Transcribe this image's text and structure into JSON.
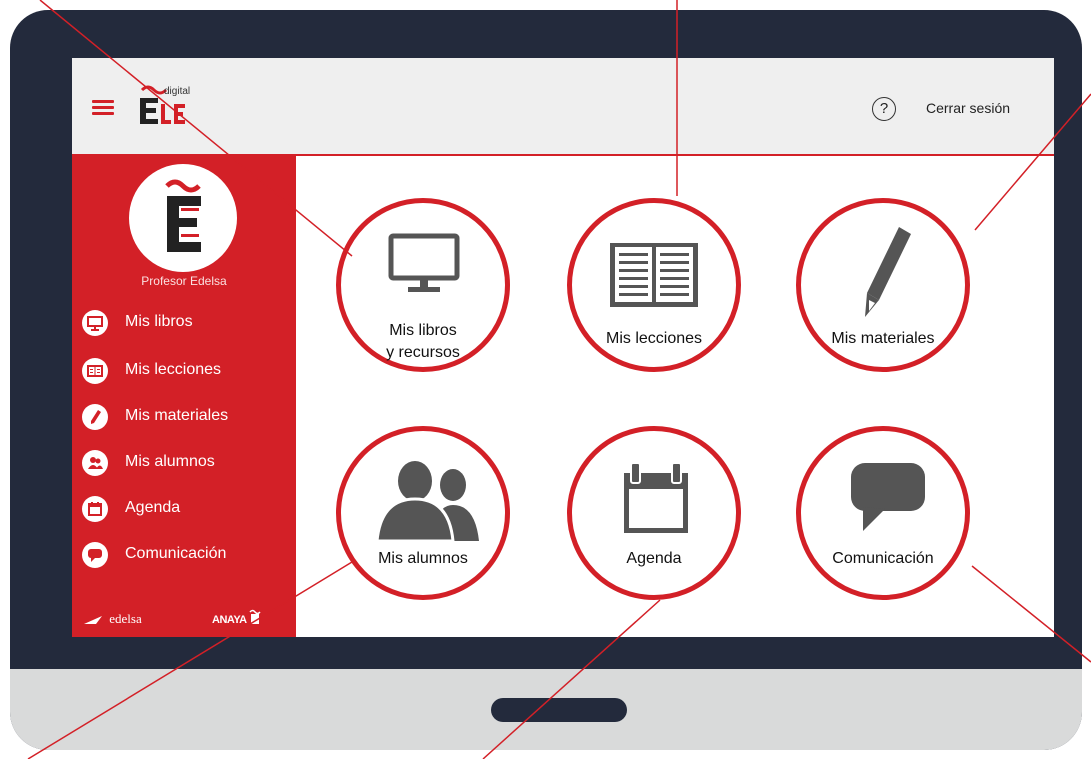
{
  "app": {
    "logo_small": "digital",
    "logo_text": "ELE"
  },
  "header": {
    "help_icon": "?",
    "logout_label": "Cerrar sesión"
  },
  "sidebar": {
    "profile_name": "Profesor Edelsa",
    "items": [
      {
        "label": "Mis libros",
        "icon": "monitor-icon"
      },
      {
        "label": "Mis lecciones",
        "icon": "book-icon"
      },
      {
        "label": "Mis materiales",
        "icon": "pencil-icon"
      },
      {
        "label": "Mis alumnos",
        "icon": "users-icon"
      },
      {
        "label": "Agenda",
        "icon": "calendar-icon"
      },
      {
        "label": "Comunicación",
        "icon": "chat-icon"
      }
    ],
    "brands": {
      "edelsa": "edelsa",
      "anaya": "ANAYA"
    }
  },
  "tiles": [
    {
      "label_line1": "Mis libros",
      "label_line2": "y recursos",
      "icon": "monitor-icon"
    },
    {
      "label_line1": "Mis lecciones",
      "label_line2": "",
      "icon": "book-icon"
    },
    {
      "label_line1": "Mis materiales",
      "label_line2": "",
      "icon": "pencil-icon"
    },
    {
      "label_line1": "Mis alumnos",
      "label_line2": "",
      "icon": "users-icon"
    },
    {
      "label_line1": "Agenda",
      "label_line2": "",
      "icon": "calendar-icon"
    },
    {
      "label_line1": "Comunicación",
      "label_line2": "",
      "icon": "chat-icon"
    }
  ],
  "colors": {
    "accent": "#d32027",
    "device": "#232a3c",
    "icon_gray": "#555555"
  }
}
